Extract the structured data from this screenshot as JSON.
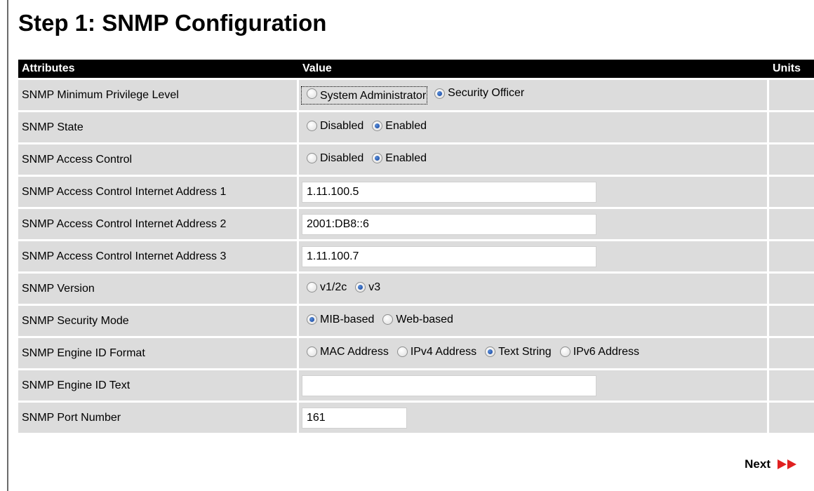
{
  "page": {
    "title": "Step 1: SNMP Configuration"
  },
  "table": {
    "headers": {
      "attributes": "Attributes",
      "value": "Value",
      "units": "Units"
    },
    "rows": [
      {
        "label": "SNMP Minimum Privilege Level",
        "type": "radio",
        "options": [
          {
            "label": "System Administrator",
            "selected": false,
            "focused": true
          },
          {
            "label": "Security Officer",
            "selected": true
          }
        ]
      },
      {
        "label": "SNMP State",
        "type": "radio",
        "options": [
          {
            "label": "Disabled",
            "selected": false
          },
          {
            "label": "Enabled",
            "selected": true
          }
        ]
      },
      {
        "label": "SNMP Access Control",
        "type": "radio",
        "options": [
          {
            "label": "Disabled",
            "selected": false
          },
          {
            "label": "Enabled",
            "selected": true
          }
        ]
      },
      {
        "label": "SNMP Access Control Internet Address 1",
        "type": "text",
        "value": "1.11.100.5"
      },
      {
        "label": "SNMP Access Control Internet Address 2",
        "type": "text",
        "value": "2001:DB8::6"
      },
      {
        "label": "SNMP Access Control Internet Address 3",
        "type": "text",
        "value": "1.11.100.7"
      },
      {
        "label": "SNMP Version",
        "type": "radio",
        "options": [
          {
            "label": "v1/2c",
            "selected": false
          },
          {
            "label": "v3",
            "selected": true
          }
        ]
      },
      {
        "label": "SNMP Security Mode",
        "type": "radio",
        "options": [
          {
            "label": "MIB-based",
            "selected": true
          },
          {
            "label": "Web-based",
            "selected": false
          }
        ]
      },
      {
        "label": "SNMP Engine ID Format",
        "type": "radio",
        "options": [
          {
            "label": "MAC Address",
            "selected": false
          },
          {
            "label": "IPv4 Address",
            "selected": false
          },
          {
            "label": "Text String",
            "selected": true
          },
          {
            "label": "IPv6 Address",
            "selected": false
          }
        ]
      },
      {
        "label": "SNMP Engine ID Text",
        "type": "text",
        "value": ""
      },
      {
        "label": "SNMP Port Number",
        "type": "text",
        "value": "161",
        "short": true
      }
    ]
  },
  "footer": {
    "next_label": "Next",
    "next_icon": "double-chevron-right-icon",
    "accent": "#e02020"
  }
}
